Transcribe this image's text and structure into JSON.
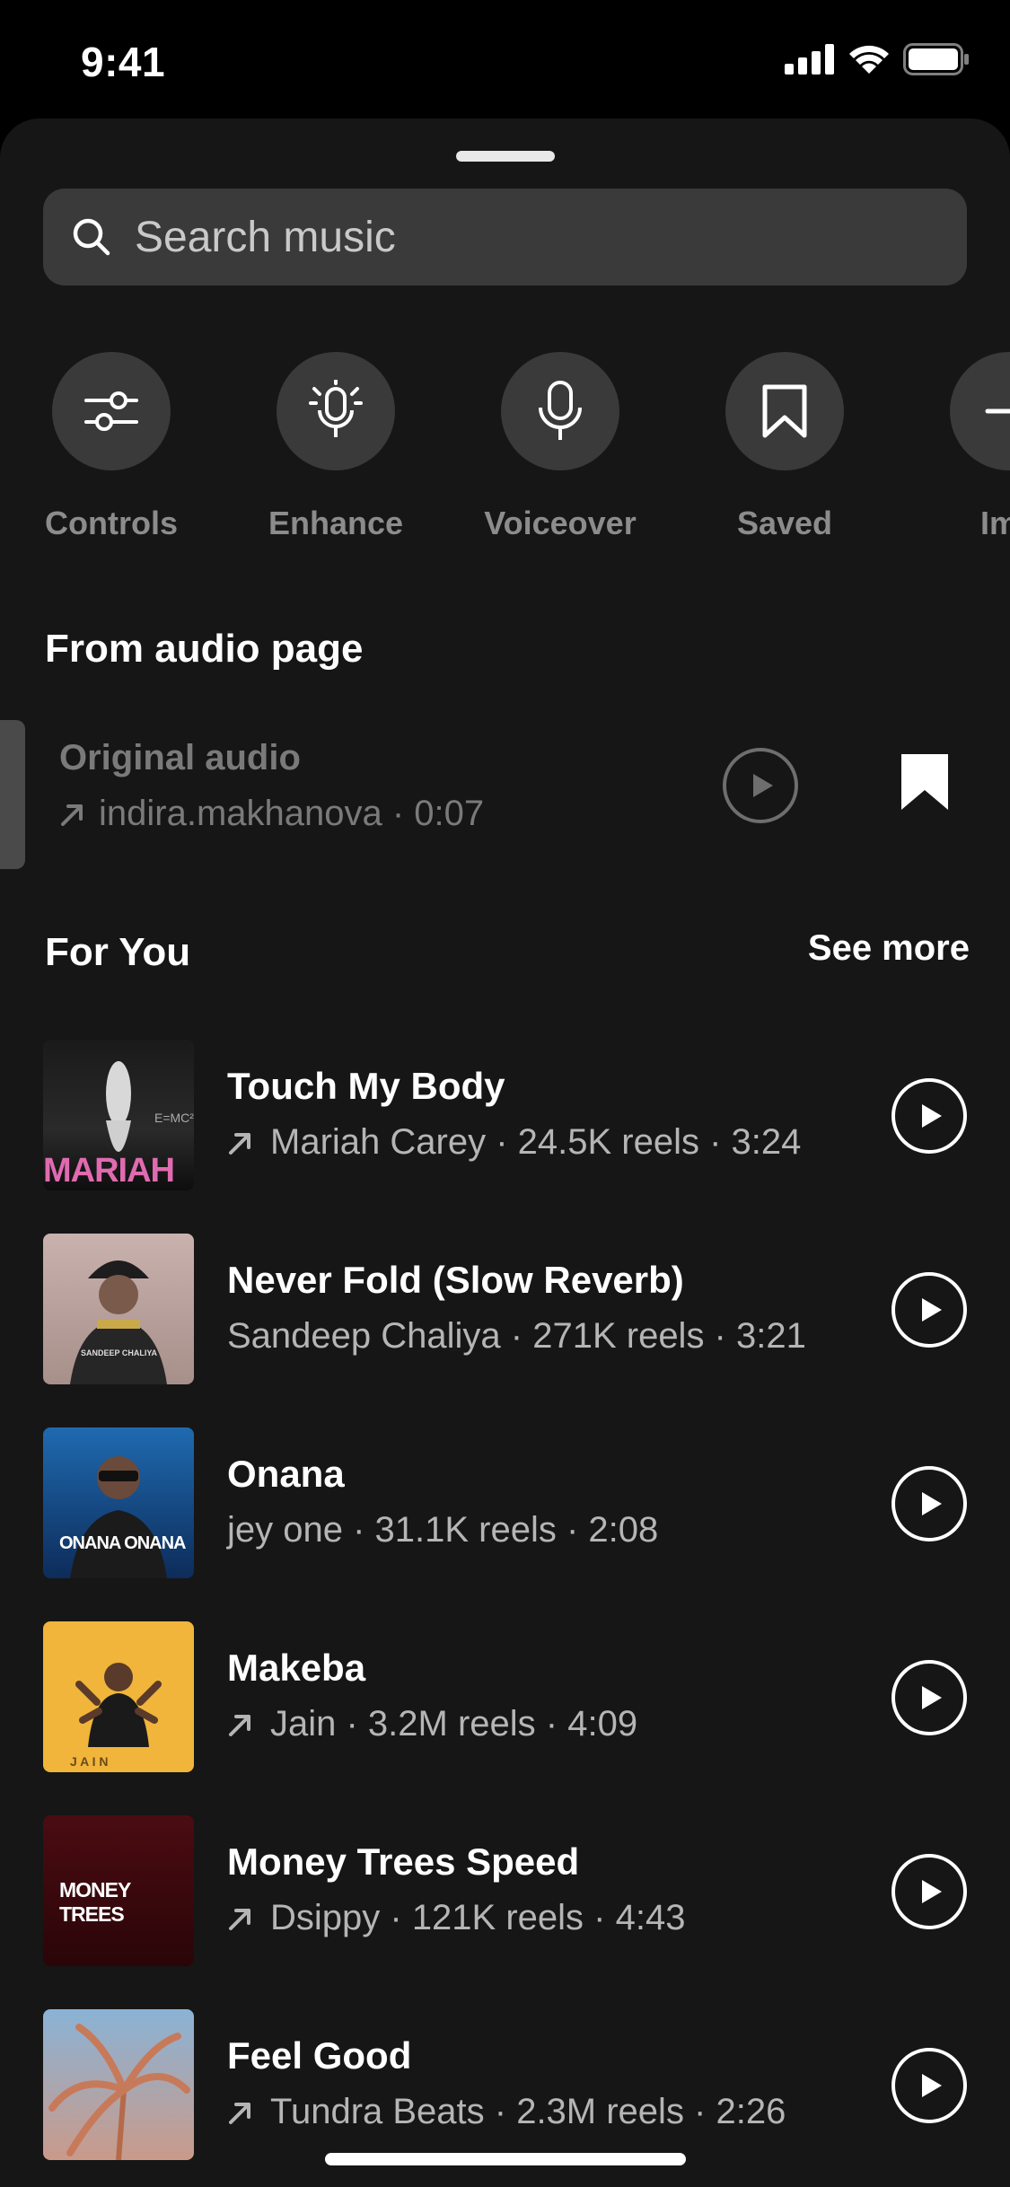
{
  "status": {
    "time": "9:41"
  },
  "search": {
    "placeholder": "Search music"
  },
  "tools": [
    {
      "label": "Controls",
      "icon": "sliders-icon"
    },
    {
      "label": "Enhance",
      "icon": "mic-sparkle-icon"
    },
    {
      "label": "Voiceover",
      "icon": "microphone-icon"
    },
    {
      "label": "Saved",
      "icon": "bookmark-icon"
    },
    {
      "label": "Imp",
      "icon": "import-icon"
    }
  ],
  "from_audio": {
    "heading": "From audio page",
    "title": "Original audio",
    "subtitle": "indira.makhanova · 0:07"
  },
  "for_you": {
    "heading": "For You",
    "see_more": "See more",
    "tracks": [
      {
        "title": "Touch My Body",
        "subtitle": "Mariah Carey · 24.5K reels · 3:24",
        "trending": true,
        "thumb_text": "MARIAH"
      },
      {
        "title": "Never Fold (Slow Reverb)",
        "subtitle": "Sandeep Chaliya · 271K reels · 3:21",
        "trending": false,
        "thumb_text": "SANDEEP CHALIYA"
      },
      {
        "title": "Onana",
        "subtitle": "jey one · 31.1K reels · 2:08",
        "trending": false,
        "thumb_text": "ONANA ONANA"
      },
      {
        "title": "Makeba",
        "subtitle": "Jain · 3.2M reels · 4:09",
        "trending": true,
        "thumb_text": "J A I N"
      },
      {
        "title": "Money Trees Speed",
        "subtitle": "Dsippy · 121K reels · 4:43",
        "trending": true,
        "thumb_text": "MONEY TREES"
      },
      {
        "title": "Feel Good",
        "subtitle": "Tundra Beats · 2.3M reels · 2:26",
        "trending": true,
        "thumb_text": ""
      }
    ]
  },
  "colors": {
    "background": "#161616",
    "surface": "#3a3a3a",
    "muted_text": "#8c8c8c",
    "secondary_text": "#b5b5b5"
  }
}
